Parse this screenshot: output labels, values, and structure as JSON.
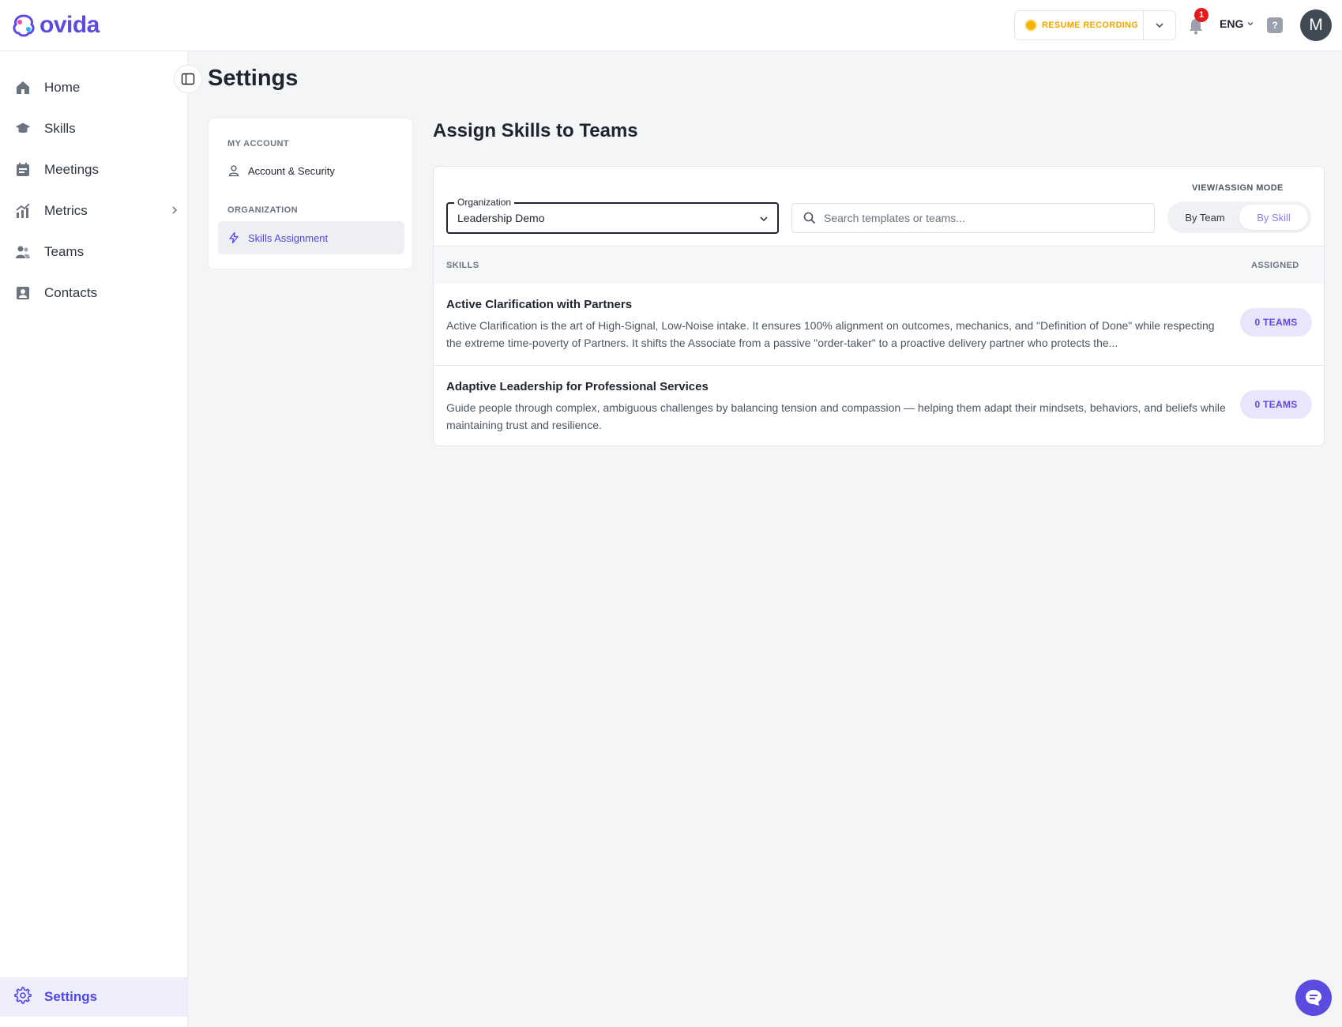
{
  "brand": {
    "name": "ovida",
    "color": "#5b4be0"
  },
  "topbar": {
    "resume_label": "RESUME RECORDING",
    "notification_count": "1",
    "language": "ENG",
    "help": "?",
    "avatar_initial": "M"
  },
  "sidebar": {
    "items": [
      {
        "label": "Home",
        "icon": "home-icon"
      },
      {
        "label": "Skills",
        "icon": "graduation-cap-icon"
      },
      {
        "label": "Meetings",
        "icon": "calendar-icon"
      },
      {
        "label": "Metrics",
        "icon": "chart-icon"
      },
      {
        "label": "Teams",
        "icon": "users-icon"
      },
      {
        "label": "Contacts",
        "icon": "contact-card-icon"
      }
    ],
    "settings_label": "Settings"
  },
  "page": {
    "title": "Settings"
  },
  "settings_nav": {
    "sections": [
      {
        "title": "MY ACCOUNT",
        "items": [
          {
            "label": "Account & Security",
            "icon": "user-icon"
          }
        ]
      },
      {
        "title": "ORGANIZATION",
        "items": [
          {
            "label": "Skills Assignment",
            "icon": "bolt-icon",
            "active": true
          }
        ]
      }
    ]
  },
  "content": {
    "title": "Assign Skills to Teams",
    "organization": {
      "legend": "Organization",
      "value": "Leadership Demo"
    },
    "search": {
      "placeholder": "Search templates or teams..."
    },
    "mode": {
      "label": "VIEW/ASSIGN MODE",
      "options": [
        "By Team",
        "By Skill"
      ],
      "selected": "By Skill"
    },
    "table": {
      "headers": {
        "skills": "SKILLS",
        "assigned": "ASSIGNED"
      },
      "rows": [
        {
          "title": "Active Clarification with Partners",
          "description": "Active Clarification is the art of High-Signal, Low-Noise intake. It ensures 100% alignment on outcomes, mechanics, and \"Definition of Done\" while respecting the extreme time-poverty of Partners. It shifts the Associate from a passive \"order-taker\" to a proactive delivery partner who protects the...",
          "assigned": "0 TEAMS"
        },
        {
          "title": "Adaptive Leadership for Professional Services",
          "description": "Guide people through complex, ambiguous challenges by balancing tension and compassion — helping them adapt their mindsets, behaviors, and beliefs while maintaining trust and resilience.",
          "assigned": "0 TEAMS"
        }
      ]
    }
  }
}
